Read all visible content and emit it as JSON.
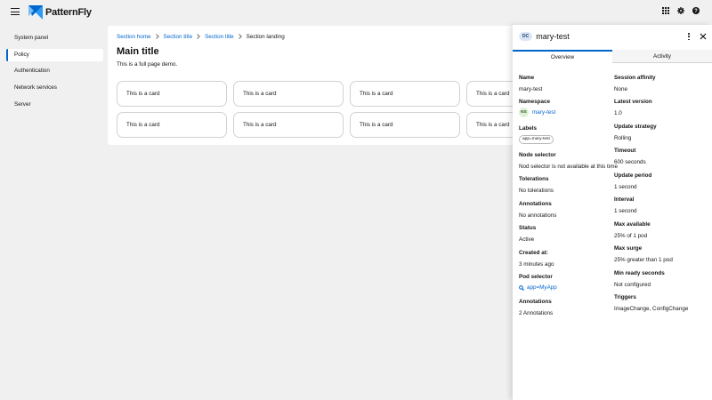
{
  "header": {
    "brand": "PatternFly",
    "icons": [
      "hamburger-icon",
      "grid-icon",
      "gear-icon",
      "help-icon"
    ]
  },
  "sidebar": {
    "items": [
      {
        "label": "System panel",
        "active": false
      },
      {
        "label": "Policy",
        "active": true
      },
      {
        "label": "Authentication",
        "active": false
      },
      {
        "label": "Network services",
        "active": false
      },
      {
        "label": "Server",
        "active": false
      }
    ]
  },
  "main": {
    "breadcrumbs": [
      "Section home",
      "Section title",
      "Section title",
      "Section landing"
    ],
    "title": "Main title",
    "description": "This is a full page demo.",
    "cards": [
      "This is a card",
      "This is a card",
      "This is a card",
      "This is a card",
      "This is a card",
      "This is a card",
      "This is a card",
      "This is a card"
    ]
  },
  "drawer": {
    "badge": "DC",
    "title": "mary-test",
    "tabs": [
      "Overview",
      "Activity"
    ],
    "active_tab": "Overview",
    "left": {
      "name_label": "Name",
      "name_value": "mary-test",
      "namespace_label": "Namespace",
      "namespace_badge": "NS",
      "namespace_value": "mary-test",
      "labels_label": "Labels",
      "labels_value": "app=mary-test",
      "node_selector_label": "Node selector",
      "node_selector_value": "Nod selector is not available at this time",
      "tolerations_label": "Tolerations",
      "tolerations_value": "No tolerations",
      "annotations_label": "Annotations",
      "annotations_value": "No annotations",
      "status_label": "Status",
      "status_value": "Active",
      "created_label": "Created at:",
      "created_value": "3 minutes ago",
      "pod_selector_label": "Pod selector",
      "pod_selector_value": "app=MyApp",
      "annotations2_label": "Annotations",
      "annotations2_value": "2 Annotations"
    },
    "right": {
      "session_affinity_label": "Session affinity",
      "session_affinity_value": "None",
      "latest_version_label": "Latest version",
      "latest_version_value": "1.0",
      "update_strategy_label": "Update strategy",
      "update_strategy_value": "Rolling",
      "timeout_label": "Timeout",
      "timeout_value": "600 seconds",
      "update_period_label": "Update period",
      "update_period_value": "1 second",
      "interval_label": "Interval",
      "interval_value": "1 second",
      "max_available_label": "Max available",
      "max_available_value": "25% of 1 pod",
      "max_surge_label": "Max surge",
      "max_surge_value": "25% greater than 1 pod",
      "min_ready_label": "Min ready seconds",
      "min_ready_value": "Not configured",
      "triggers_label": "Triggers",
      "triggers_value": "ImageChange, ConfigChange"
    }
  }
}
